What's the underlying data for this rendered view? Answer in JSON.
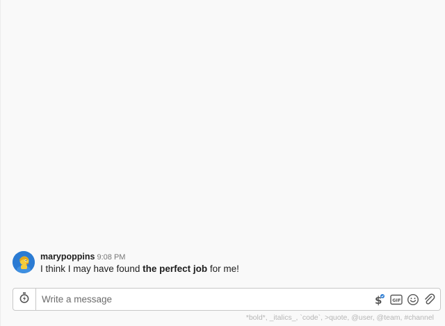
{
  "message": {
    "username": "marypoppins",
    "time": "9:08 PM",
    "text_before": "I think I may have found ",
    "text_bold": "the perfect job",
    "text_after": " for me!"
  },
  "composer": {
    "placeholder": "Write a message",
    "hint": "*bold*, _italics_, `code`, >quote, @user, @team, #channel"
  },
  "icons": {
    "left": "commands-icon",
    "tools": [
      "payment-icon",
      "gif-icon",
      "emoji-icon",
      "attachment-icon"
    ]
  },
  "colors": {
    "background": "#f9f9f9",
    "avatar": "#2b7bd3",
    "border": "#c7c7c7",
    "hint_text": "#b5b5b5"
  }
}
